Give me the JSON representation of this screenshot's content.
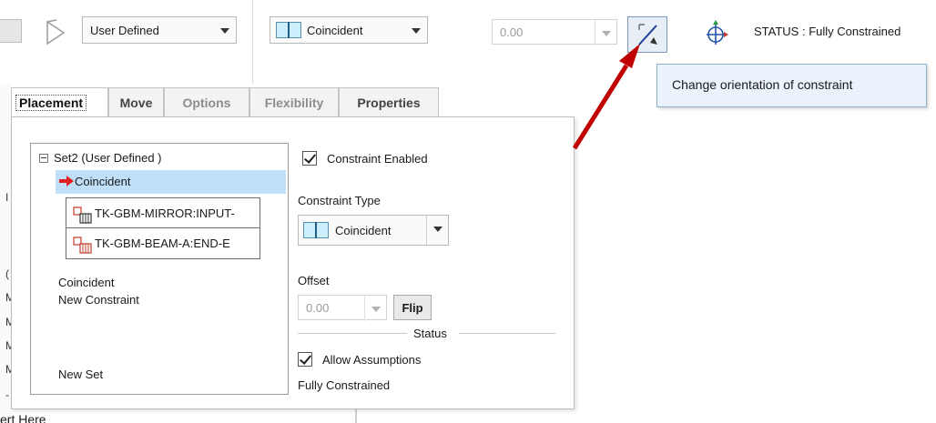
{
  "toolbar": {
    "set_type": "User Defined",
    "constraint_type": "Coincident",
    "offset_value": "0.00",
    "orient_button_tooltip": "Change orientation of constraint",
    "status": "STATUS : Fully Constrained"
  },
  "tabs": [
    {
      "label": "Placement",
      "active": true
    },
    {
      "label": "Move"
    },
    {
      "label": "Options"
    },
    {
      "label": "Flexibility"
    },
    {
      "label": "Properties"
    }
  ],
  "placement": {
    "set_label": "Set2 (User Defined )",
    "selected_constraint": "Coincident",
    "references": [
      "TK-GBM-MIRROR:INPUT-",
      "TK-GBM-BEAM-A:END-E"
    ],
    "constraints": [
      "Coincident",
      "New Constraint"
    ],
    "new_set": "New Set",
    "constraint_enabled_label": "Constraint Enabled",
    "constraint_enabled": true,
    "constraint_type_label": "Constraint Type",
    "constraint_type_value": "Coincident",
    "offset_label": "Offset",
    "offset_value": "0.00",
    "flip_label": "Flip",
    "status_heading": "Status",
    "allow_assumptions_label": "Allow Assumptions",
    "allow_assumptions": true,
    "status_value": "Fully Constrained"
  },
  "background": {
    "left_chars": [
      "I",
      "(",
      "M",
      "M",
      "M",
      "M",
      "-"
    ],
    "insert_here": "ert Here"
  },
  "colors": {
    "selection": "#bfe0f8",
    "annotation_arrow": "#c00000",
    "tooltip_bg": "#eaf3fb"
  }
}
